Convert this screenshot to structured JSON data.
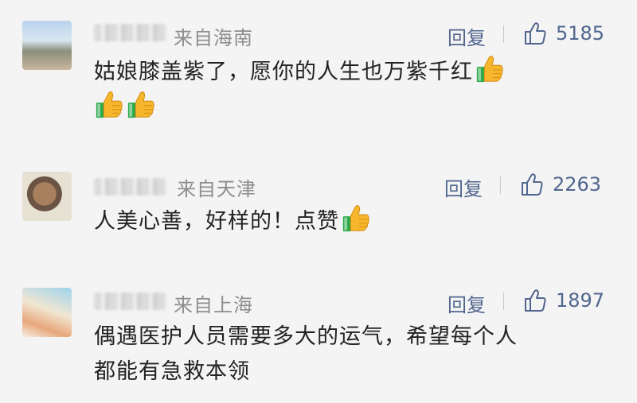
{
  "comments": [
    {
      "avatar_icon": "user-avatar",
      "location": "来自海南",
      "reply_label": "回复",
      "like_icon": "thumbs-up-outline-icon",
      "likes": "5185",
      "text_line1": "姑娘膝盖紫了，愿你的人生也万紫千红",
      "text_line2": "",
      "emoji": "thumbs-up-emoji",
      "emoji_count": 3
    },
    {
      "avatar_icon": "user-avatar",
      "location": "来自天津",
      "reply_label": "回复",
      "like_icon": "thumbs-up-outline-icon",
      "likes": "2263",
      "text_line1": "人美心善，好样的！点赞",
      "text_line2": "",
      "emoji": "thumbs-up-emoji",
      "emoji_count": 1
    },
    {
      "avatar_icon": "user-avatar",
      "location": "来自上海",
      "reply_label": "回复",
      "like_icon": "thumbs-up-outline-icon",
      "likes": "1897",
      "text_line1": "偶遇医护人员需要多大的运气，希望每个人",
      "text_line2": "都能有急救本领",
      "emoji": "",
      "emoji_count": 0
    }
  ],
  "colors": {
    "background": "#f4f4f4",
    "link_blue": "#51668e",
    "meta_gray": "#8d8d8d",
    "text": "#222222",
    "emoji_yellow": "#f6b72c",
    "emoji_green": "#2aa84a"
  }
}
